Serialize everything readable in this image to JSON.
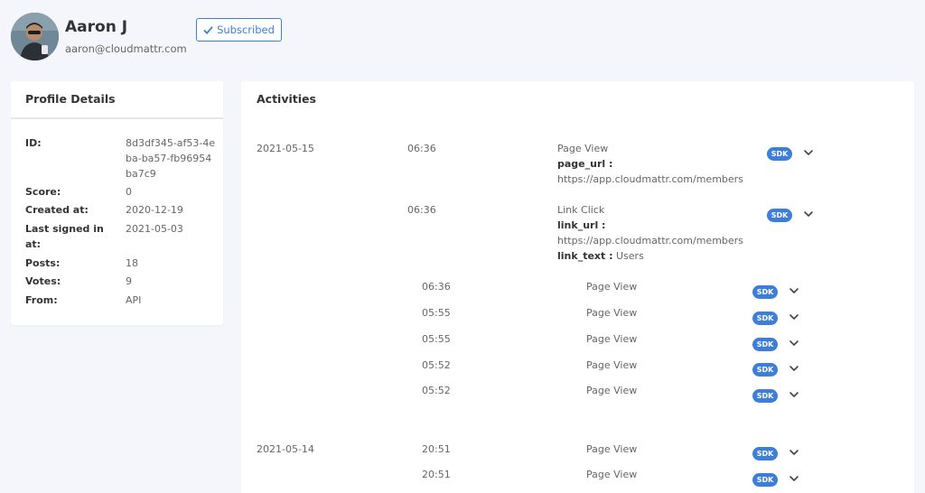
{
  "user": {
    "name": "Aaron J",
    "email": "aaron@cloudmattr.com",
    "subscribe_label": "Subscribed"
  },
  "profile": {
    "title": "Profile Details",
    "fields": [
      {
        "key": "ID:",
        "value": "8d3df345-af53-4eba-ba57-fb96954ba7c9"
      },
      {
        "key": "Score:",
        "value": "0"
      },
      {
        "key": "Created at:",
        "value": "2020-12-19"
      },
      {
        "key": "Last signed in at:",
        "value": "2021-05-03"
      },
      {
        "key": "Posts:",
        "value": "18"
      },
      {
        "key": "Votes:",
        "value": "9"
      },
      {
        "key": "From:",
        "value": "API"
      }
    ]
  },
  "activities": {
    "title": "Activities",
    "dates": [
      "2021-05-15",
      "2021-05-14"
    ],
    "detailed": [
      {
        "time": "06:36",
        "event": "Page View",
        "props": [
          {
            "key": "page_url :",
            "value": "https://app.cloudmattr.com/members"
          }
        ],
        "badge": "SDK"
      },
      {
        "time": "06:36",
        "event": "Link Click",
        "props": [
          {
            "key": "link_url :",
            "value": "https://app.cloudmattr.com/members"
          },
          {
            "key": "link_text :",
            "value": "Users"
          }
        ],
        "badge": "SDK"
      }
    ],
    "compact": [
      {
        "time": "06:36",
        "event": "Page View",
        "badge": "SDK"
      },
      {
        "time": "05:55",
        "event": "Page View",
        "badge": "SDK"
      },
      {
        "time": "05:55",
        "event": "Page View",
        "badge": "SDK"
      },
      {
        "time": "05:52",
        "event": "Page View",
        "badge": "SDK"
      },
      {
        "time": "05:52",
        "event": "Page View",
        "badge": "SDK"
      },
      {
        "time": "20:51",
        "event": "Page View",
        "badge": "SDK"
      },
      {
        "time": "20:51",
        "event": "Page View",
        "badge": "SDK"
      }
    ]
  },
  "colors": {
    "accent": "#3d7edb",
    "background": "#f4f6fb"
  }
}
